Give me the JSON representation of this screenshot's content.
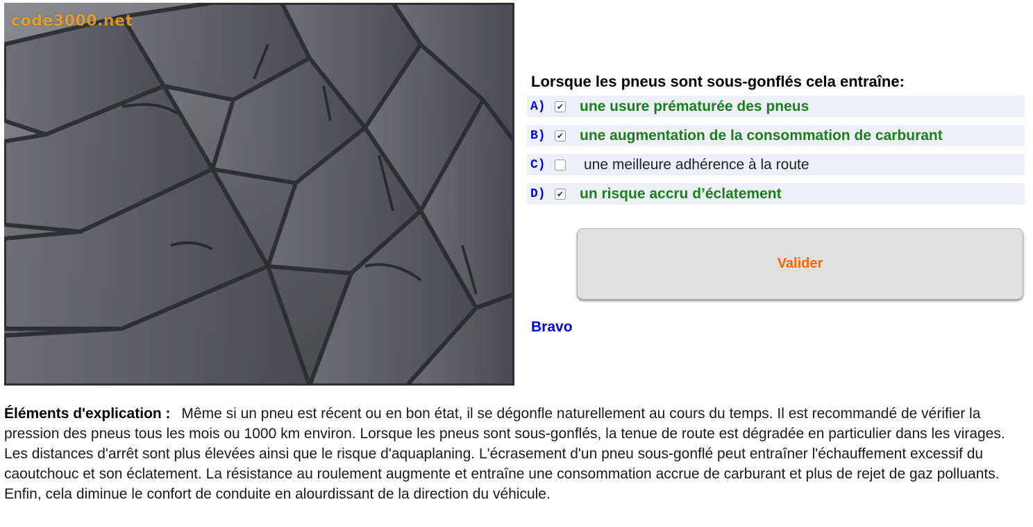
{
  "photo": {
    "watermark": "code3000.net"
  },
  "quiz": {
    "question": "Lorsque les pneus sont sous-gonflés cela entraîne:",
    "answers": [
      {
        "letter": "A)",
        "text": "une usure prématurée des pneus",
        "checked": true
      },
      {
        "letter": "B)",
        "text": "une augmentation de la consommation de carburant",
        "checked": true
      },
      {
        "letter": "C)",
        "text": "une meilleure adhérence à la route",
        "checked": false
      },
      {
        "letter": "D)",
        "text": "un risque accru d’éclatement",
        "checked": true
      }
    ],
    "validate_label": "Valider",
    "feedback": "Bravo"
  },
  "explanation": {
    "label": "Éléments d'explication :",
    "text": "Même si un pneu est récent ou en bon état, il se dégonfle naturellement au cours du temps. Il est recommandé de vérifier la pression des pneus tous les mois ou 1000 km environ. Lorsque les pneus sont sous-gonflés, la tenue de route est dégradée en particulier dans les virages. Les distances d'arrêt sont plus élevées ainsi que le risque d'aquaplaning. L'écrasement d'un pneu sous-gonflé peut entraîner l'échauffement excessif du caoutchouc et son éclatement. La résistance au roulement augmente et entraîne une consommation accrue de carburant et plus de rejet de gaz polluants. Enfin, cela diminue le confort de conduite en alourdissant de la direction du véhicule."
  },
  "colors": {
    "correct_answer": "#1a7f1a",
    "letter": "#0000dd",
    "validate_text": "#ff6600",
    "feedback": "#0000dd",
    "answer_row_bg": "#eef0f8"
  }
}
